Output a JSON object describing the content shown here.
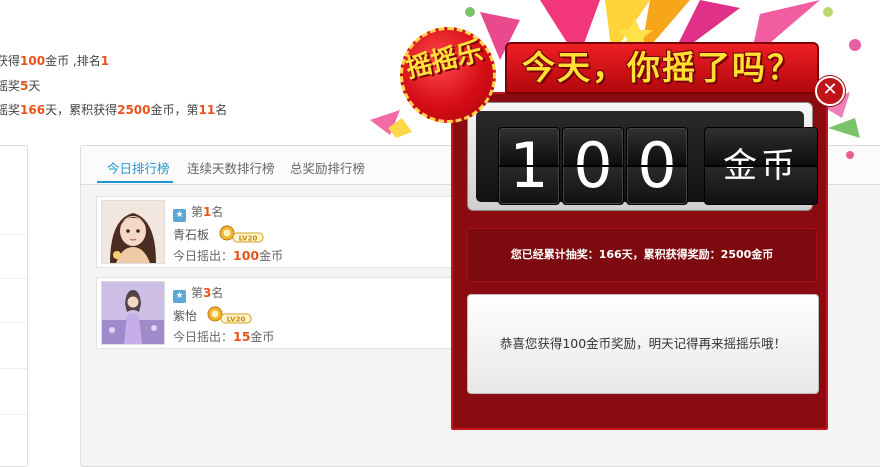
{
  "summary": {
    "line1": {
      "pre": "获得",
      "coins": "100",
      "mid": "金币 ,排名",
      "rank": "1"
    },
    "line2": {
      "pre": "摇奖",
      "days": "5",
      "post": "天"
    },
    "line3": {
      "pre": "摇奖",
      "days": "166",
      "mid1": "天，累积获得",
      "coins": "2500",
      "mid2": "金币，第",
      "rank": "11",
      "post": "名"
    }
  },
  "ranking": {
    "tabs": [
      {
        "label": "今日排行榜",
        "active": true
      },
      {
        "label": "连续天数排行榜",
        "active": false
      },
      {
        "label": "总奖励排行榜",
        "active": false
      }
    ],
    "rank_prefix": "第",
    "rank_suffix": "名",
    "out_prefix": "今日摇出：",
    "out_suffix": "金币",
    "level_badge": "LV20",
    "entries": [
      {
        "rank": "1",
        "name": "青石板",
        "amount": "100"
      },
      {
        "rank": "3",
        "name": "紫怡",
        "amount": "15"
      }
    ]
  },
  "popup": {
    "badge": "摇摇乐",
    "title": "今天，你摇了吗？",
    "digits": [
      "1",
      "0",
      "0"
    ],
    "unit": "金币",
    "stats": "您已经累计抽奖：166天，累积获得奖励：2500金币",
    "message": "恭喜您获得100金币奖励，明天记得再来摇摇乐哦！",
    "close_label": "✕"
  },
  "colors": {
    "accent_blue": "#2196d3",
    "highlight_orange": "#e8541a",
    "popup_red": "#8b0b10"
  }
}
